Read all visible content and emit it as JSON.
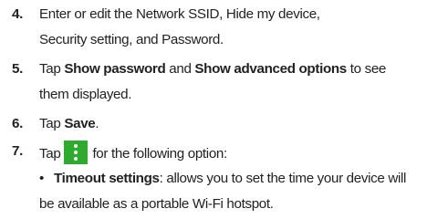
{
  "steps": [
    {
      "num": "4.",
      "line1": "Enter or edit the Network SSID, Hide my device,",
      "line2": "Security setting, and Password."
    },
    {
      "num": "5.",
      "pre": "Tap ",
      "b1": "Show password",
      "mid": " and ",
      "b2": "Show advanced options",
      "post": " to see",
      "line2": "them displayed."
    },
    {
      "num": "6.",
      "pre": "Tap ",
      "b1": "Save",
      "post": "."
    },
    {
      "num": "7.",
      "pre": "Tap",
      "icon": "overflow-menu-icon",
      "post": "for the following option:"
    }
  ],
  "bullet": {
    "dot": "•",
    "label": "Timeout settings",
    "line1_rest": ": allows you to set the time your device will",
    "line2": "be available as a portable Wi-Fi hotspot."
  },
  "colors": {
    "icon_bg": "#2eaa2e",
    "text": "#222222"
  }
}
